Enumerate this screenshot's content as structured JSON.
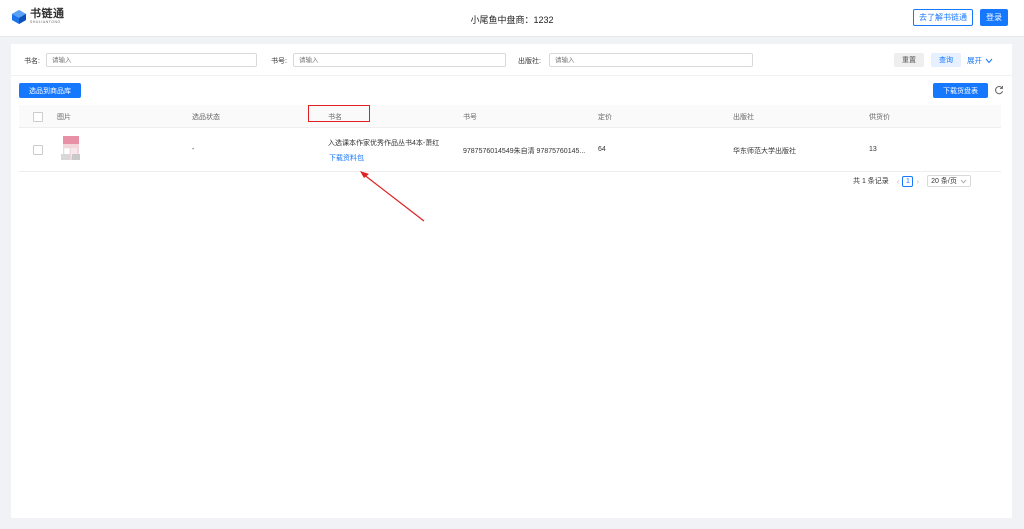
{
  "header": {
    "logo_cn": "书链通",
    "logo_en": "SHULIANTONG",
    "merchant": "小尾鱼中盘商：1232",
    "learn_button": "去了解书链通",
    "login_button": "登录"
  },
  "filters": {
    "title_label": "书名:",
    "title_placeholder": "请输入",
    "isbn_label": "书号:",
    "isbn_placeholder": "请输入",
    "publisher_label": "出版社:",
    "publisher_placeholder": "请输入",
    "reset_button": "重置",
    "query_button": "查询",
    "expand_button": "展开"
  },
  "toolbar": {
    "select_to_library": "选品到商品库",
    "download_list": "下载货盘表"
  },
  "table": {
    "columns": [
      "图片",
      "选品状态",
      "书名",
      "书号",
      "定价",
      "出版社",
      "供货价"
    ],
    "rows": [
      {
        "status": "-",
        "title": "入选课本作家优秀作品丛书4本-萧红",
        "download_link": "下载资料包",
        "isbn": "9787576014549朱自清 97875760145...",
        "price": "64",
        "publisher": "华东师范大学出版社",
        "supply_price": "13"
      }
    ]
  },
  "pagination": {
    "total": "共 1 条记录",
    "current_page": "1",
    "page_size": "20 条/页"
  },
  "colors": {
    "primary": "#1677ff",
    "annotation": "#e02020"
  }
}
